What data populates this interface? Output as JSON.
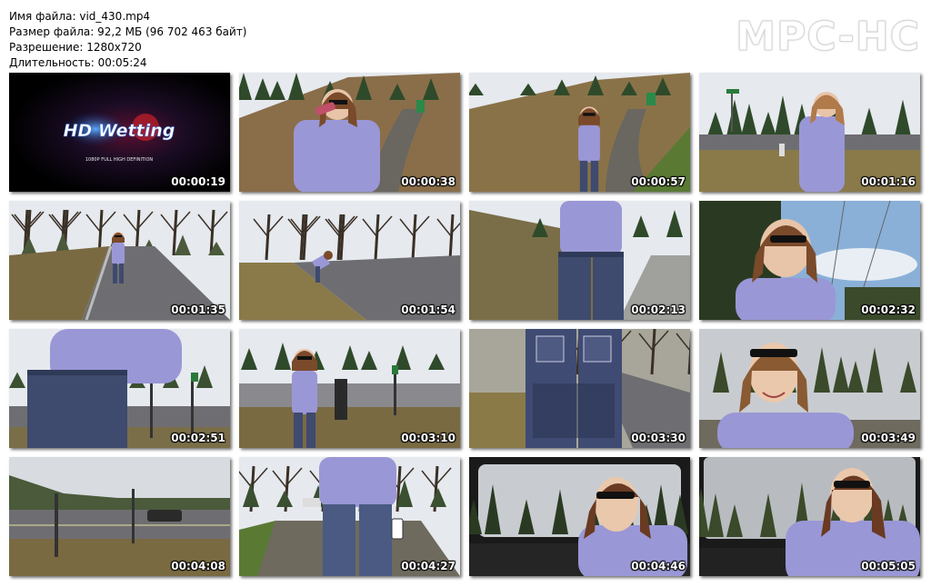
{
  "info": {
    "filename": "Имя файла: vid_430.mp4",
    "filesize": "Размер файла: 92,2 МБ (96 702 463 байт)",
    "resolution": "Разрешение: 1280x720",
    "duration": "Длительность: 00:05:24"
  },
  "logo": "MPC-HC",
  "title_card": {
    "brand": "HD Wetting",
    "tagline": "1080P FULL HIGH DEFINITION"
  },
  "thumbnails": [
    {
      "time": "00:00:19",
      "scene": "title-card"
    },
    {
      "time": "00:00:38",
      "scene": "drinking-bottle"
    },
    {
      "time": "00:00:57",
      "scene": "walking-path"
    },
    {
      "time": "00:01:16",
      "scene": "roadside-drinking"
    },
    {
      "time": "00:01:35",
      "scene": "road-distance"
    },
    {
      "time": "00:01:54",
      "scene": "road-bending"
    },
    {
      "time": "00:02:13",
      "scene": "jeans-back-hill"
    },
    {
      "time": "00:02:32",
      "scene": "face-closeup-sky"
    },
    {
      "time": "00:02:51",
      "scene": "jeans-side-road"
    },
    {
      "time": "00:03:10",
      "scene": "standing-roadside"
    },
    {
      "time": "00:03:30",
      "scene": "wet-jeans-back"
    },
    {
      "time": "00:03:49",
      "scene": "smiling-closeup"
    },
    {
      "time": "00:04:08",
      "scene": "road-with-car"
    },
    {
      "time": "00:04:27",
      "scene": "walking-with-bottle"
    },
    {
      "time": "00:04:46",
      "scene": "car-interior"
    },
    {
      "time": "00:05:05",
      "scene": "car-interior-side"
    }
  ],
  "colors": {
    "hoodie": "#9a97d6",
    "jeans": "#3e4a6e",
    "road": "#6e6e72",
    "grass": "#8a7a4a",
    "forest": "#2f4a2a",
    "sky": "#e6e9ee"
  }
}
